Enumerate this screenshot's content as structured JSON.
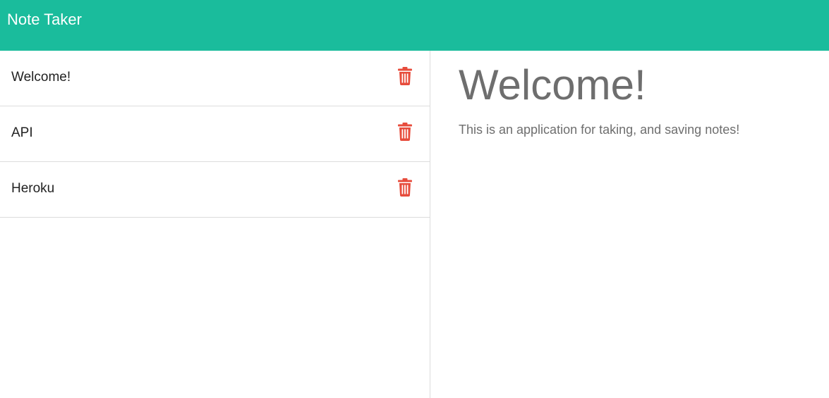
{
  "navbar": {
    "brand": "Note Taker",
    "background": "#1abc9c"
  },
  "notes": [
    {
      "title": "Welcome!",
      "delete_icon": "trash-icon"
    },
    {
      "title": "API",
      "delete_icon": "trash-icon"
    },
    {
      "title": "Heroku",
      "delete_icon": "trash-icon"
    }
  ],
  "active_note": {
    "title": "Welcome!",
    "text": "This is an application for taking, and saving notes!"
  },
  "colors": {
    "delete": "#e74c3c",
    "text_muted": "#6e6e6e"
  }
}
